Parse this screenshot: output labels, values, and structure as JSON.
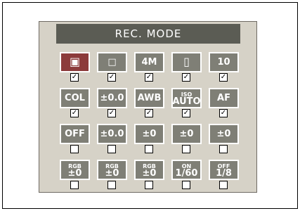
{
  "menu": {
    "title": "REC. MODE"
  },
  "rows": [
    [
      {
        "main": "",
        "sub": "",
        "icon": "program-camera-icon",
        "checked": true,
        "selected": true
      },
      {
        "main": "□",
        "sub": "",
        "icon": "single-frame-icon",
        "checked": true
      },
      {
        "main": "4M",
        "sub": "",
        "icon": "image-size-icon",
        "checked": true
      },
      {
        "main": "",
        "sub": "",
        "icon": "memory-card-icon",
        "checked": true
      },
      {
        "main": "10",
        "sub": "",
        "icon": "self-timer-icon",
        "checked": true
      }
    ],
    [
      {
        "main": "COL",
        "sub": "",
        "icon": "color-mode-icon",
        "checked": true
      },
      {
        "main": "±0.0",
        "sub": "",
        "icon": "exposure-comp-icon",
        "checked": true
      },
      {
        "main": "AWB",
        "sub": "",
        "icon": "white-balance-icon",
        "checked": true
      },
      {
        "main": "AUTO",
        "sub": "ISO",
        "icon": "iso-icon",
        "checked": true
      },
      {
        "main": "AF",
        "sub": "",
        "icon": "autofocus-icon",
        "checked": true
      }
    ],
    [
      {
        "main": "OFF",
        "sub": "",
        "icon": "face-detect-icon",
        "checked": false
      },
      {
        "main": "±0.0",
        "sub": "",
        "icon": "flash-comp-icon",
        "checked": false
      },
      {
        "main": "±0",
        "sub": "",
        "icon": "saturation-icon",
        "checked": false
      },
      {
        "main": "±0",
        "sub": "",
        "icon": "contrast-icon",
        "checked": false
      },
      {
        "main": "±0",
        "sub": "",
        "icon": "sharpness-icon",
        "checked": false
      }
    ],
    [
      {
        "main": "±0",
        "sub": "RGB",
        "icon": "red-adjust-icon",
        "checked": false
      },
      {
        "main": "±0",
        "sub": "RGB",
        "icon": "green-adjust-icon",
        "checked": false
      },
      {
        "main": "±0",
        "sub": "RGB",
        "icon": "blue-adjust-icon",
        "checked": false
      },
      {
        "main": "1/60",
        "sub": "ON",
        "icon": "flash-on-speed-icon",
        "checked": false
      },
      {
        "main": "1/8",
        "sub": "OFF",
        "icon": "flash-off-speed-icon",
        "checked": false
      }
    ]
  ],
  "colors": {
    "screen_bg": "#d6d2c7",
    "cell_bg": "#7f7f76",
    "selected_bg": "#8c3b3b",
    "title_bg": "#5b5c54"
  },
  "check_mark": "✓"
}
